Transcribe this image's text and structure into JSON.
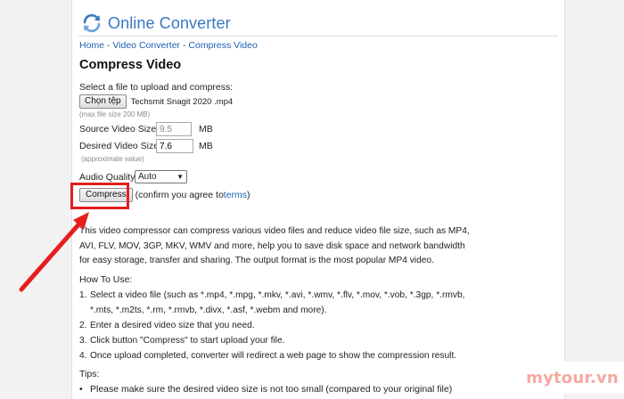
{
  "site": {
    "title": "Online Converter"
  },
  "breadcrumb": {
    "home": "Home",
    "sep1": " - ",
    "video_converter": "Video Converter",
    "sep2": " - ",
    "current": "Compress Video"
  },
  "page": {
    "heading": "Compress Video"
  },
  "form": {
    "select_label": "Select a file to upload and compress:",
    "choose_button": "Chọn tệp",
    "file_name": "Techsmit Snagit 2020 .mp4",
    "max_size_note": "(max file size 200 MB)",
    "source_label": "Source Video Size:",
    "source_value": "9.5",
    "source_unit": "MB",
    "desired_label": "Desired Video Size:",
    "desired_value": "7.6",
    "desired_unit": "MB",
    "approx_note": "(approximate value)",
    "audio_label": "Audio Quality:",
    "audio_value": "Auto",
    "compress_button": "Compress",
    "agree_text": "(confirm you agree to ",
    "terms_link": "terms",
    "agree_close": ")"
  },
  "description": "This video compressor can compress various video files and reduce video file size, such as MP4, AVI, FLV, MOV, 3GP, MKV, WMV and more, help you to save disk space and network bandwidth for easy storage, transfer and sharing. The output format is the most popular MP4 video.",
  "howto": {
    "heading": "How To Use:",
    "steps": [
      {
        "num": "1.",
        "text": "Select a video file (such as *.mp4, *.mpg, *.mkv, *.avi, *.wmv, *.flv, *.mov, *.vob, *.3gp, *.rmvb, *.mts, *.m2ts, *.rm, *.rmvb, *.divx, *.asf, *.webm and more)."
      },
      {
        "num": "2.",
        "text": "Enter a desired video size that you need."
      },
      {
        "num": "3.",
        "text": "Click button \"Compress\" to start upload your file."
      },
      {
        "num": "4.",
        "text": "Once upload completed, converter will redirect a web page to show the compression result."
      }
    ]
  },
  "tips": {
    "heading": "Tips:",
    "items": [
      "Please make sure the desired video size is not too small (compared to your original file)"
    ]
  },
  "watermark": "mytour.vn",
  "colors": {
    "link": "#1f5fb4",
    "title": "#3a78c2",
    "annotation_red": "#e51e1e",
    "watermark": "#f4a9a0"
  },
  "icons": {
    "logo": "refresh-arrows-icon",
    "annotation": "red-arrow-icon"
  }
}
